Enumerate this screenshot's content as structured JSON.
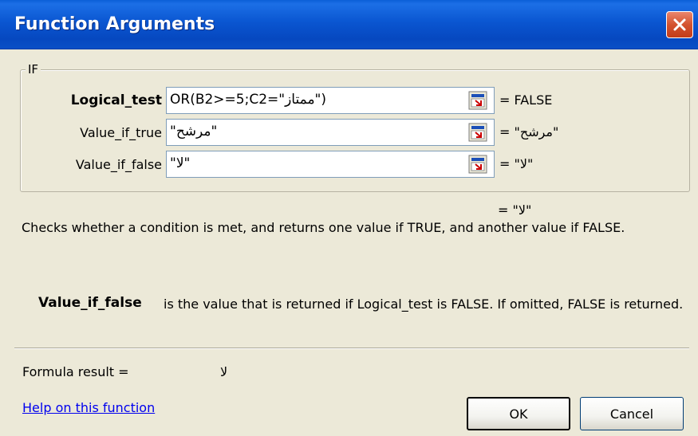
{
  "window": {
    "title": "Function Arguments"
  },
  "group": {
    "label": "IF"
  },
  "arguments": [
    {
      "label": "Logical_test",
      "value": "OR(B2>=5;C2=\"ممتاز\")",
      "result": "= FALSE"
    },
    {
      "label": "Value_if_true",
      "value": "\"مرشح\"",
      "result": "= \"مرشح\""
    },
    {
      "label": "Value_if_false",
      "value": "\"لا\"",
      "result": "= \"لا\""
    }
  ],
  "overall_result": "= \"لا\"",
  "description": "Checks whether a condition is met, and returns one value if TRUE, and another value if FALSE.",
  "parameter_help": {
    "name": "Value_if_false",
    "text": "is the value that is returned if Logical_test is FALSE. If omitted, FALSE is returned."
  },
  "formula": {
    "label": "Formula result =",
    "value": "لا"
  },
  "help_link": "Help on this function",
  "buttons": {
    "ok": "OK",
    "cancel": "Cancel"
  },
  "icons": {
    "close": "close-icon",
    "collapse": "collapse-dialog-icon"
  },
  "colors": {
    "titlebar": "#0a56d1",
    "close": "#d4532f",
    "link": "#0000ee",
    "dialog_bg": "#ece9d8"
  }
}
